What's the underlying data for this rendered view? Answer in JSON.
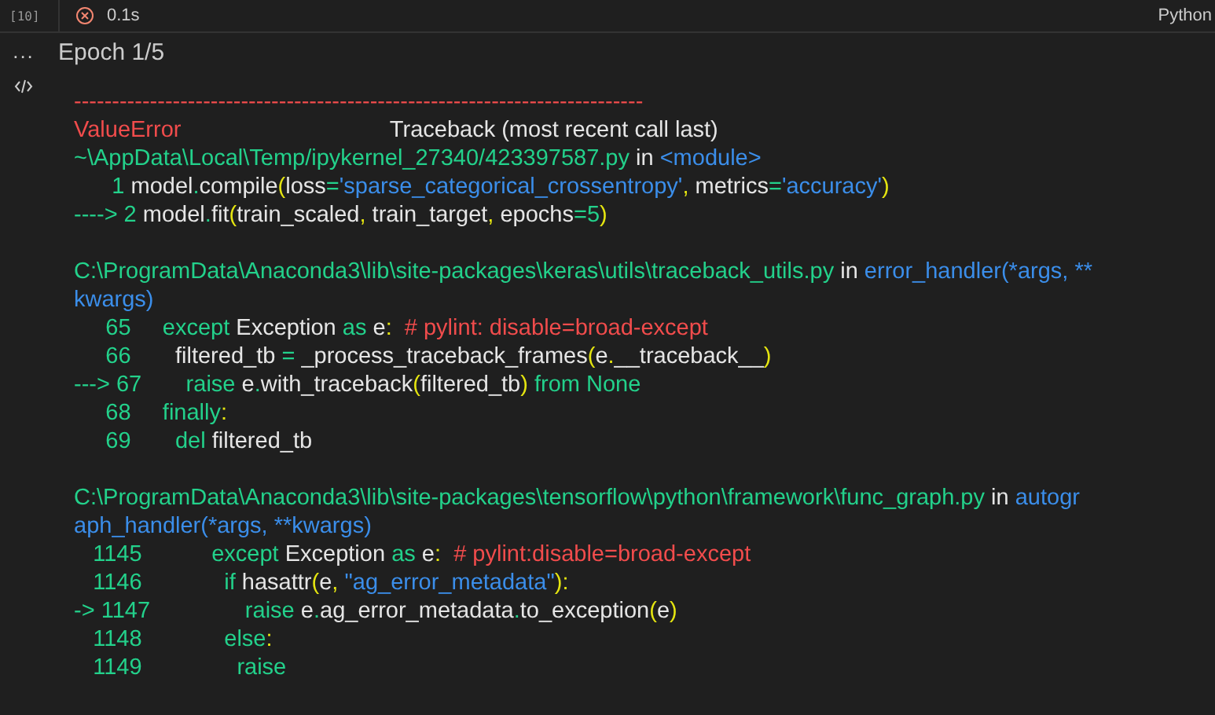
{
  "cell": {
    "execution_count": "[10]",
    "failed": true,
    "duration": "0.1s",
    "language": "Python"
  },
  "output": {
    "more_glyph": "...",
    "stream_text": "Epoch 1/5",
    "traceback_sections": [
      [
        [
          {
            "kind": "error",
            "text": "---------------------------------------------------------------------------"
          }
        ],
        [
          {
            "kind": "error",
            "text": "ValueError"
          },
          {
            "kind": "text",
            "text": "                                 Traceback (most recent call last)"
          }
        ],
        [
          {
            "kind": "path",
            "text": "~\\AppData\\Local\\Temp/ipykernel_27340/423397587.py"
          },
          {
            "kind": "text",
            "text": " in "
          },
          {
            "kind": "func",
            "text": "<module>"
          }
        ],
        [
          {
            "kind": "path",
            "text": "      1 "
          },
          {
            "kind": "text",
            "text": "model"
          },
          {
            "kind": "path",
            "text": "."
          },
          {
            "kind": "text",
            "text": "compile"
          },
          {
            "kind": "punct",
            "text": "("
          },
          {
            "kind": "text",
            "text": "loss"
          },
          {
            "kind": "path",
            "text": "="
          },
          {
            "kind": "func",
            "text": "'sparse_categorical_crossentropy'"
          },
          {
            "kind": "punct",
            "text": ","
          },
          {
            "kind": "text",
            "text": " metrics"
          },
          {
            "kind": "path",
            "text": "="
          },
          {
            "kind": "func",
            "text": "'accuracy'"
          },
          {
            "kind": "punct",
            "text": ")"
          }
        ],
        [
          {
            "kind": "path",
            "text": "----> 2 "
          },
          {
            "kind": "text",
            "text": "model"
          },
          {
            "kind": "path",
            "text": "."
          },
          {
            "kind": "text",
            "text": "fit"
          },
          {
            "kind": "punct",
            "text": "("
          },
          {
            "kind": "text",
            "text": "train_scaled"
          },
          {
            "kind": "punct",
            "text": ","
          },
          {
            "kind": "text",
            "text": " train_target"
          },
          {
            "kind": "punct",
            "text": ","
          },
          {
            "kind": "text",
            "text": " epochs"
          },
          {
            "kind": "path",
            "text": "="
          },
          {
            "kind": "path",
            "text": "5"
          },
          {
            "kind": "punct",
            "text": ")"
          }
        ]
      ],
      [
        [
          {
            "kind": "path",
            "text": "C:\\ProgramData\\Anaconda3\\lib\\site-packages\\keras\\utils\\traceback_utils.py"
          },
          {
            "kind": "text",
            "text": " in "
          },
          {
            "kind": "func",
            "text": "error_handler(*args, **"
          }
        ],
        [
          {
            "kind": "func",
            "text": "kwargs)"
          }
        ],
        [
          {
            "kind": "path",
            "text": "     65     except"
          },
          {
            "kind": "text",
            "text": " Exception "
          },
          {
            "kind": "path",
            "text": "as"
          },
          {
            "kind": "text",
            "text": " e"
          },
          {
            "kind": "punct",
            "text": ":"
          },
          {
            "kind": "error",
            "text": "  # pylint: disable=broad-except"
          }
        ],
        [
          {
            "kind": "path",
            "text": "     66       "
          },
          {
            "kind": "text",
            "text": "filtered_tb "
          },
          {
            "kind": "path",
            "text": "="
          },
          {
            "kind": "text",
            "text": " _process_traceback_frames"
          },
          {
            "kind": "punct",
            "text": "("
          },
          {
            "kind": "text",
            "text": "e"
          },
          {
            "kind": "punct",
            "text": "."
          },
          {
            "kind": "text",
            "text": "__traceback__"
          },
          {
            "kind": "punct",
            "text": ")"
          }
        ],
        [
          {
            "kind": "path",
            "text": "---> 67       raise"
          },
          {
            "kind": "text",
            "text": " e"
          },
          {
            "kind": "path",
            "text": "."
          },
          {
            "kind": "text",
            "text": "with_traceback"
          },
          {
            "kind": "punct",
            "text": "("
          },
          {
            "kind": "text",
            "text": "filtered_tb"
          },
          {
            "kind": "punct",
            "text": ")"
          },
          {
            "kind": "path",
            "text": " from None"
          }
        ],
        [
          {
            "kind": "path",
            "text": "     68     finally"
          },
          {
            "kind": "punct",
            "text": ":"
          }
        ],
        [
          {
            "kind": "path",
            "text": "     69       del"
          },
          {
            "kind": "text",
            "text": " filtered_tb"
          }
        ]
      ],
      [
        [
          {
            "kind": "path",
            "text": "C:\\ProgramData\\Anaconda3\\lib\\site-packages\\tensorflow\\python\\framework\\func_graph.py"
          },
          {
            "kind": "text",
            "text": " in "
          },
          {
            "kind": "func",
            "text": "autogr"
          }
        ],
        [
          {
            "kind": "func",
            "text": "aph_handler(*args, **kwargs)"
          }
        ],
        [
          {
            "kind": "path",
            "text": "   1145           except"
          },
          {
            "kind": "text",
            "text": " Exception "
          },
          {
            "kind": "path",
            "text": "as"
          },
          {
            "kind": "text",
            "text": " e"
          },
          {
            "kind": "punct",
            "text": ":"
          },
          {
            "kind": "error",
            "text": "  # pylint:disable=broad-except"
          }
        ],
        [
          {
            "kind": "path",
            "text": "   1146             if"
          },
          {
            "kind": "text",
            "text": " hasattr"
          },
          {
            "kind": "punct",
            "text": "("
          },
          {
            "kind": "text",
            "text": "e"
          },
          {
            "kind": "punct",
            "text": ","
          },
          {
            "kind": "func",
            "text": " \"ag_error_metadata\""
          },
          {
            "kind": "punct",
            "text": "):"
          }
        ],
        [
          {
            "kind": "path",
            "text": "-> 1147               raise"
          },
          {
            "kind": "text",
            "text": " e"
          },
          {
            "kind": "path",
            "text": "."
          },
          {
            "kind": "text",
            "text": "ag_error_metadata"
          },
          {
            "kind": "path",
            "text": "."
          },
          {
            "kind": "text",
            "text": "to_exception"
          },
          {
            "kind": "punct",
            "text": "("
          },
          {
            "kind": "text",
            "text": "e"
          },
          {
            "kind": "punct",
            "text": ")"
          }
        ],
        [
          {
            "kind": "path",
            "text": "   1148             else"
          },
          {
            "kind": "punct",
            "text": ":"
          }
        ],
        [
          {
            "kind": "path",
            "text": "   1149               raise"
          }
        ]
      ]
    ]
  }
}
